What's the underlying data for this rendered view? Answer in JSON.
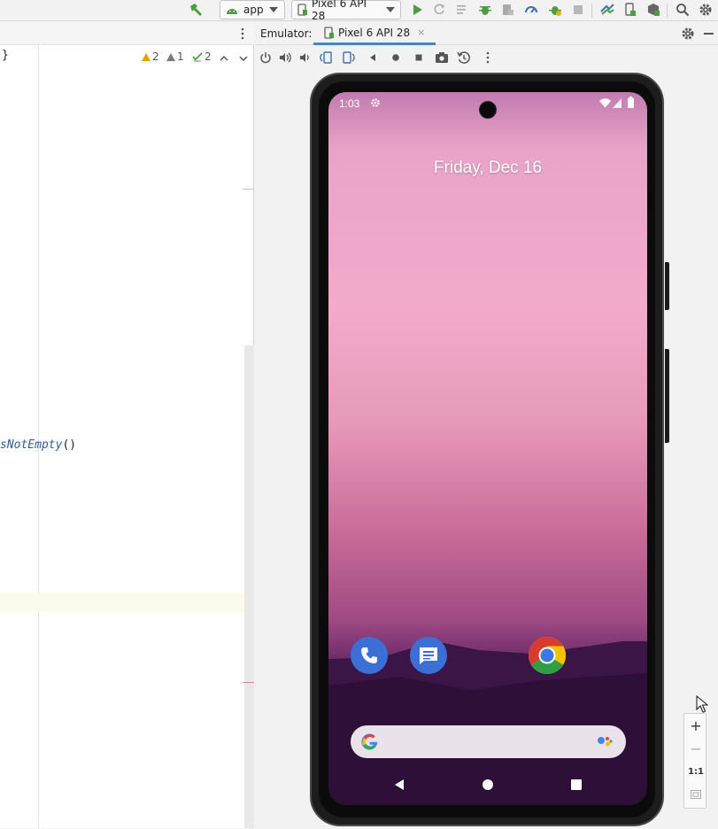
{
  "toolbar": {
    "run_config": "app",
    "device": "Pixel 6 API 28",
    "icons": [
      "hammer-icon",
      "android-icon",
      "device-icon",
      "run-icon",
      "apply-changes-icon",
      "apply-code-icon",
      "debug-icon",
      "attach-debugger-icon",
      "profile-icon",
      "coverage-icon",
      "stop-icon",
      "sync-icon",
      "device-manager-icon",
      "sdk-icon",
      "search-icon",
      "settings-icon"
    ]
  },
  "editor": {
    "closing_brace": "}",
    "inspections": {
      "warnings": "2",
      "weak_warnings": "1",
      "typos": "2"
    },
    "code_fragment": {
      "fn": "sNotEmpty",
      "parens": "()"
    }
  },
  "emulator": {
    "label": "Emulator:",
    "tab_label": "Pixel 6 API 28",
    "tab_close": "×",
    "controls": [
      "power-icon",
      "volume-up-icon",
      "volume-down-icon",
      "rotate-left-icon",
      "rotate-right-icon",
      "back-icon",
      "home-icon",
      "overview-icon",
      "screenshot-icon",
      "snapshot-icon",
      "more-icon"
    ]
  },
  "phone": {
    "time": "1:03",
    "date": "Friday, Dec 16",
    "apps": [
      "phone",
      "messages",
      "chrome"
    ]
  },
  "zoom": {
    "plus": "+",
    "minus": "−",
    "one_to_one": "1:1"
  },
  "colors": {
    "accent": "#4a82c6",
    "run": "#4a9e3d",
    "warning": "#e3a400"
  }
}
